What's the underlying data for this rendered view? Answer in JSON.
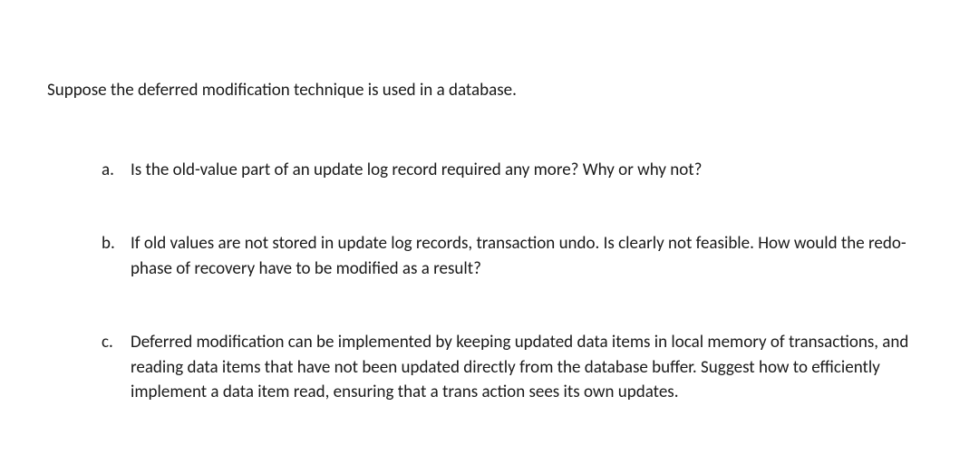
{
  "intro": "Suppose the deferred modification technique is used in a database.",
  "items": [
    {
      "marker": "a.",
      "text": "Is the old-value part of an update log record required any more? Why or why not?"
    },
    {
      "marker": "b.",
      "text": "If old values are not stored in update log records, transaction undo. Is clearly not feasible. How would the redo-phase of recovery have to be modified as a result?"
    },
    {
      "marker": "c.",
      "text": "Deferred modification can be implemented by keeping updated data items in local memory of transactions, and reading data items that have not been updated directly from the database buffer. Suggest how to efficiently implement a data item read, ensuring that a trans action sees its own updates."
    }
  ]
}
